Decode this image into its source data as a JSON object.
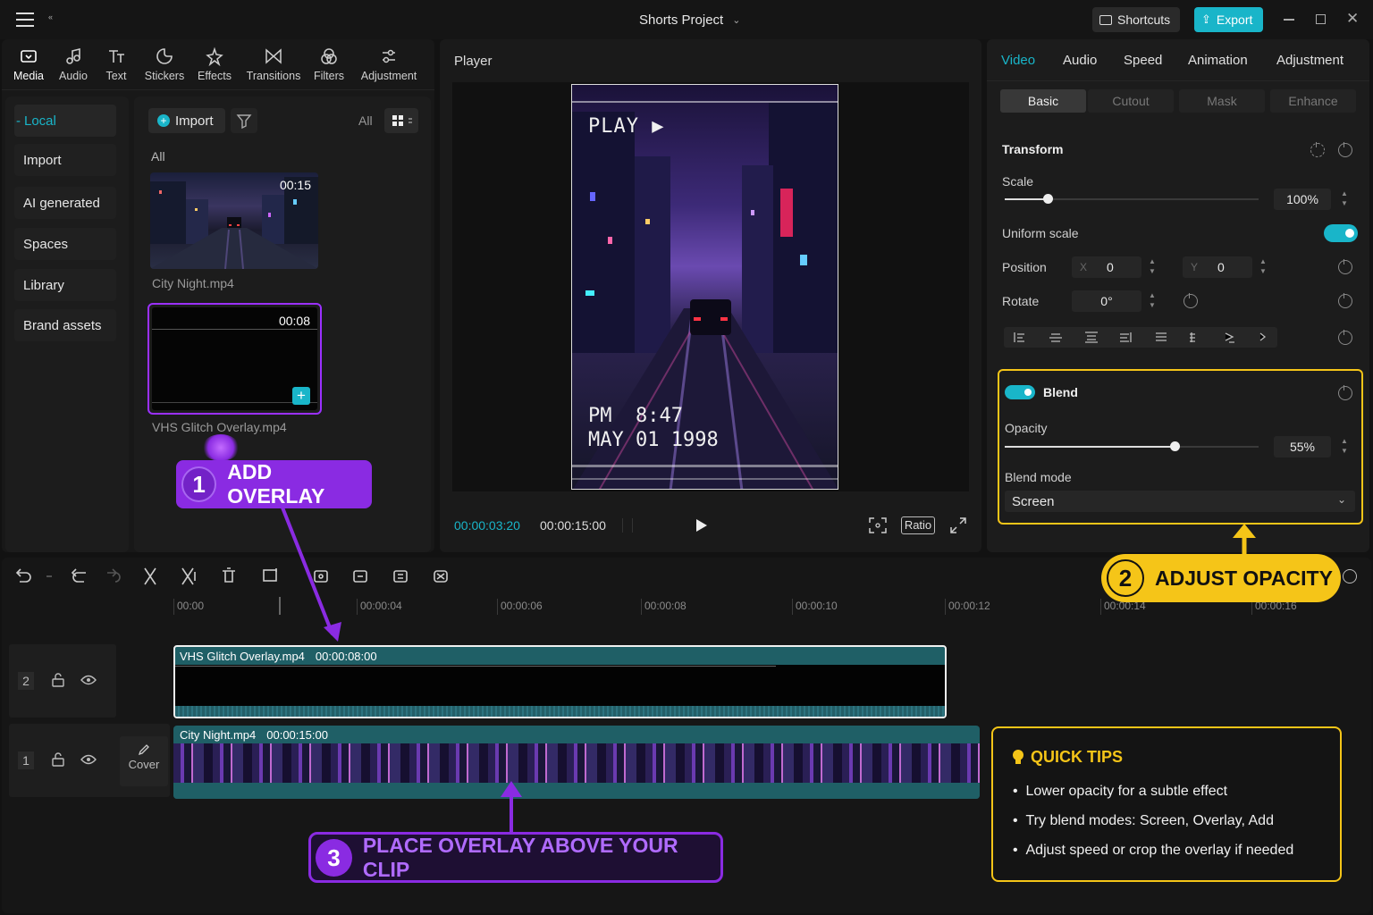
{
  "app": {
    "project_title": "Shorts Project",
    "shortcuts_label": "Shortcuts",
    "export_label": "Export"
  },
  "toolbar": {
    "tools": [
      {
        "label": "Media",
        "icon": "media-icon"
      },
      {
        "label": "Audio",
        "icon": "audio-icon"
      },
      {
        "label": "Text",
        "icon": "text-icon"
      },
      {
        "label": "Stickers",
        "icon": "stickers-icon"
      },
      {
        "label": "Effects",
        "icon": "effects-icon"
      },
      {
        "label": "Transitions",
        "icon": "transitions-icon"
      },
      {
        "label": "Filters",
        "icon": "filters-icon"
      },
      {
        "label": "Adjustment",
        "icon": "adjustment-icon"
      }
    ]
  },
  "sidebar": {
    "items": [
      {
        "label": "Local"
      },
      {
        "label": "Import"
      },
      {
        "label": "AI generated"
      },
      {
        "label": "Spaces"
      },
      {
        "label": "Library"
      },
      {
        "label": "Brand assets"
      }
    ]
  },
  "media": {
    "import_label": "Import",
    "filter_all": "All",
    "section_label": "All",
    "clips": [
      {
        "name": "City Night.mp4",
        "duration": "00:15"
      },
      {
        "name": "VHS Glitch Overlay.mp4",
        "duration": "00:08"
      }
    ]
  },
  "player": {
    "title": "Player",
    "overlay_play": "PLAY ▶",
    "overlay_time": "PM  8:47",
    "overlay_date": "MAY 01 1998",
    "current_time": "00:00:03:20",
    "total_time": "00:00:15:00",
    "ratio_label": "Ratio"
  },
  "properties": {
    "tabs": [
      "Video",
      "Audio",
      "Speed",
      "Animation",
      "Adjustment"
    ],
    "subtabs": [
      "Basic",
      "Cutout",
      "Mask",
      "Enhance"
    ],
    "transform_title": "Transform",
    "scale_label": "Scale",
    "scale_value": "100%",
    "scale_fraction": 0.17,
    "uniform_scale_label": "Uniform scale",
    "uniform_scale_on": true,
    "position_label": "Position",
    "pos_x_label": "X",
    "pos_x": "0",
    "pos_y_label": "Y",
    "pos_y": "0",
    "rotate_label": "Rotate",
    "rotate_value": "0°",
    "blend_title": "Blend",
    "blend_on": true,
    "opacity_label": "Opacity",
    "opacity_value": "55%",
    "opacity_fraction": 0.67,
    "blend_mode_label": "Blend mode",
    "blend_mode_value": "Screen"
  },
  "timeline": {
    "ticks": [
      "00:00",
      "00:00:04",
      "00:00:06",
      "00:00:08",
      "00:00:10",
      "00:00:12",
      "00:00:14",
      "00:00:16"
    ],
    "tracks": [
      {
        "index": "2",
        "clip_name": "VHS Glitch Overlay.mp4",
        "clip_duration": "00:00:08:00"
      },
      {
        "index": "1",
        "clip_name": "City Night.mp4",
        "clip_duration": "00:00:15:00",
        "cover_label": "Cover"
      }
    ]
  },
  "callouts": {
    "step1_num": "1",
    "step1_text": "ADD OVERLAY",
    "step2_num": "2",
    "step2_text": "ADJUST OPACITY",
    "step3_num": "3",
    "step3_text": "PLACE OVERLAY ABOVE YOUR CLIP"
  },
  "tips": {
    "title": "QUICK TIPS",
    "items": [
      "Lower opacity for a subtle effect",
      "Try blend modes: Screen, Overlay, Add",
      "Adjust speed or crop the overlay if needed"
    ]
  },
  "colors": {
    "accent_cyan": "#19b5c9",
    "purple": "#8a2be2",
    "yellow": "#f5c518",
    "clip_teal": "#1f5f66"
  }
}
